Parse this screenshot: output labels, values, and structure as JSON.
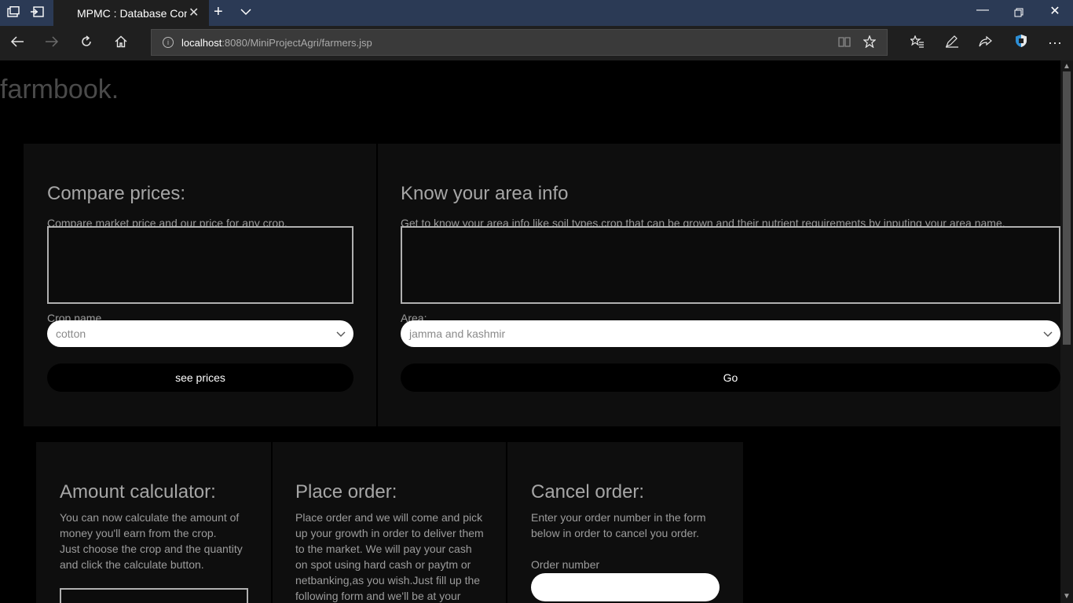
{
  "browser": {
    "tab_title": "MPMC : Database Conn",
    "url_host": "localhost",
    "url_path": ":8080/MiniProjectAgri/farmers.jsp"
  },
  "page": {
    "brand": "farmbook.",
    "compare": {
      "title": "Compare prices:",
      "description": "Compare market price and our price for any crop.",
      "crop_label": "Crop name",
      "crop_selected": "cotton",
      "button": "see prices"
    },
    "area": {
      "title": "Know your area info",
      "description": "Get to know your area info like soil types,crop that can be grown and their nutrient requirements by inputing your area name.",
      "area_label": "Area:",
      "area_selected": "jamma and kashmir",
      "button": "Go"
    },
    "calculator": {
      "title": "Amount calculator:",
      "description_lines": [
        "You can now calculate the amount of",
        "money you'll earn from the crop.",
        "Just choose the crop and the quantity",
        "and click the calculate button."
      ]
    },
    "place_order": {
      "title": "Place order:",
      "description_lines": [
        "Place order and we will come and pick",
        "up your growth in order to deliver them",
        "to the market. We will pay your cash",
        "on spot using hard cash or paytm or",
        "netbanking,as you wish.Just fill up the",
        "following form and we'll be at your"
      ]
    },
    "cancel_order": {
      "title": "Cancel order:",
      "description_lines": [
        "Enter your order number in the form",
        "below in order to cancel you order."
      ],
      "order_label": "Order number"
    }
  },
  "icons": {
    "tab_actions": "tab-actions-icon",
    "set_aside": "set-aside-icon",
    "back": "back-arrow-icon",
    "forward": "forward-arrow-icon",
    "refresh": "refresh-icon",
    "home": "home-icon",
    "reading_view": "reading-view-icon",
    "favorite": "star-icon",
    "favorites_hub": "favorites-hub-icon",
    "notes": "pen-icon",
    "share": "share-icon",
    "shield": "shield-extension-icon",
    "more": "more-icon"
  }
}
